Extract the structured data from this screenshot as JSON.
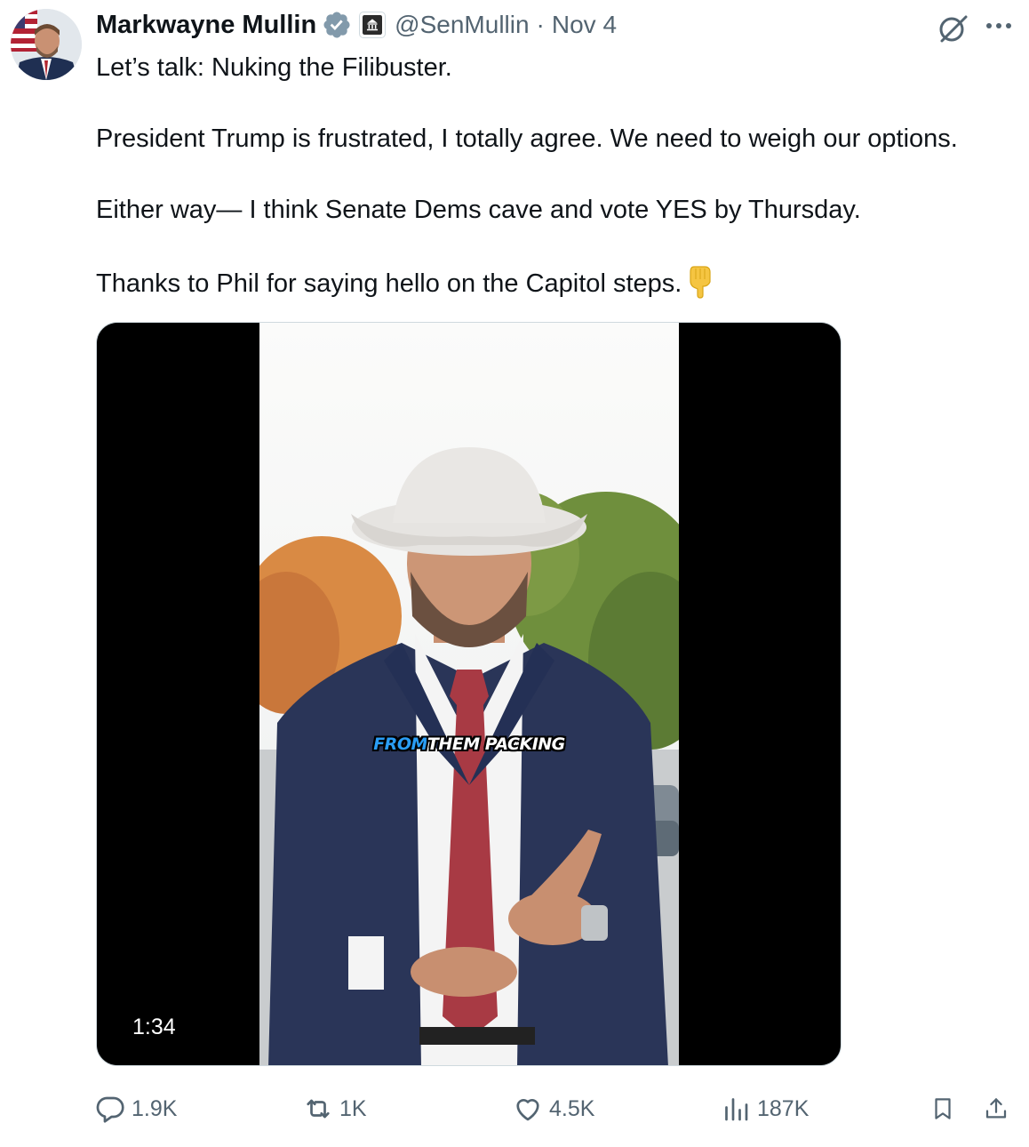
{
  "author": {
    "name": "Markwayne Mullin",
    "handle": "@SenMullin",
    "separator": "·",
    "date": "Nov 4",
    "verified_icon": "verified-badge-icon",
    "affiliation_icon": "capitol-building-icon",
    "colors": {
      "verified": "#829aab",
      "text": "#0f1419",
      "muted": "#536471"
    }
  },
  "top_actions": {
    "grok_icon": "grok-icon",
    "more_icon": "more-dots-icon"
  },
  "tweet": {
    "line1": "Let’s talk: Nuking the Filibuster.",
    "line2": "President Trump is frustrated, I totally agree. We need to weigh our options.",
    "line3": "Either way— I think Senate Dems cave and vote YES by Thursday.",
    "line4": "Thanks to Phil for saying hello on the Capitol steps.",
    "emoji": "backhand-index-pointing-down"
  },
  "media": {
    "type": "video",
    "duration": "1:34",
    "caption_part1": "FROM",
    "caption_part2": "THEM PACKING",
    "caption_colors": {
      "highlight": "#2a9df4",
      "rest": "#ffffff"
    }
  },
  "actions": {
    "replies": "1.9K",
    "reposts": "1K",
    "likes": "4.5K",
    "views": "187K",
    "bookmark_icon": "bookmark-icon",
    "share_icon": "share-icon"
  }
}
